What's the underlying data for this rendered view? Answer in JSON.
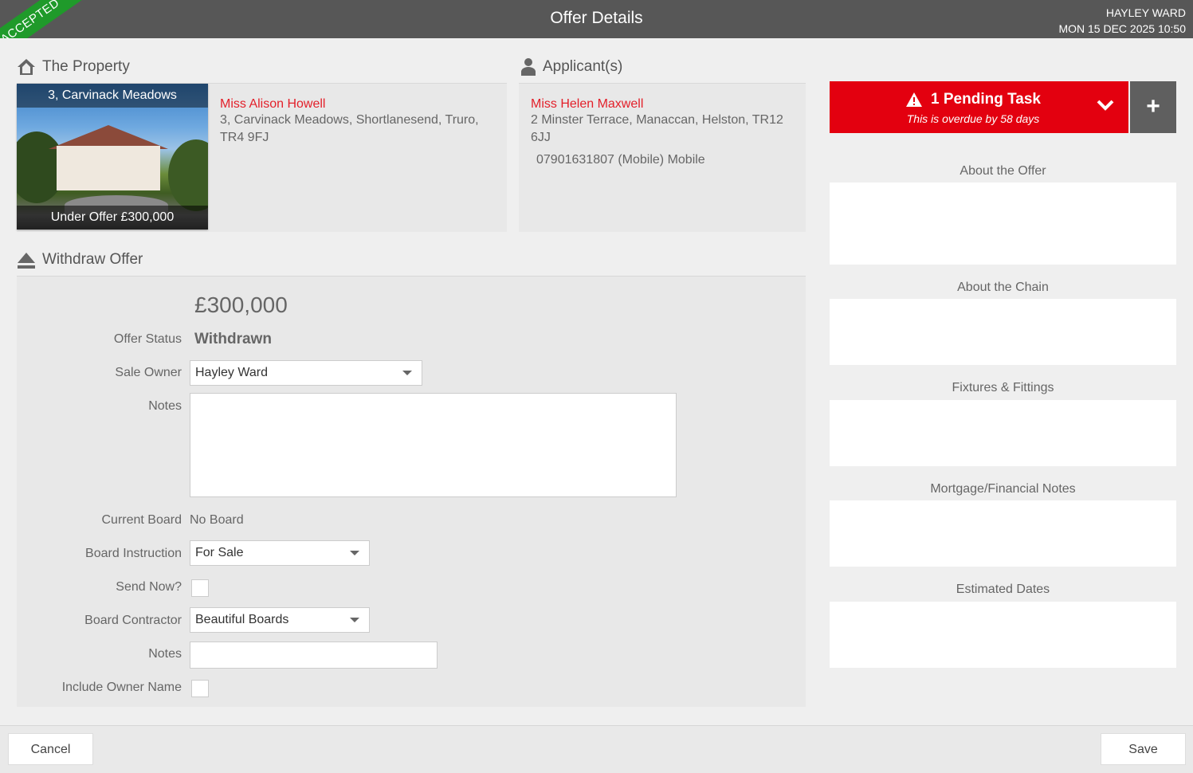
{
  "header": {
    "title": "Offer Details",
    "user_name": "HAYLEY WARD",
    "datetime": "MON 15 DEC 2025 10:50",
    "status_ribbon": "ACCEPTED"
  },
  "property": {
    "section_title": "The Property",
    "photo_caption_top": "3, Carvinack Meadows",
    "photo_caption_bottom": "Under Offer £300,000",
    "owner_name": "Miss Alison Howell",
    "address_line1": "3, Carvinack Meadows, Shortlanesend, Truro,",
    "address_line2": "TR4 9FJ"
  },
  "applicant": {
    "section_title": "Applicant(s)",
    "name": "Miss Helen Maxwell",
    "address_line1": "2 Minster Terrace, Manaccan, Helston, TR12",
    "address_line2": "6JJ",
    "phone": "07901631807 (Mobile) Mobile"
  },
  "withdraw": {
    "section_title": "Withdraw Offer",
    "amount": "£300,000",
    "offer_status_label": "Offer Status",
    "offer_status_value": "Withdrawn",
    "sale_owner_label": "Sale Owner",
    "sale_owner_value": "Hayley Ward",
    "notes_label": "Notes",
    "current_board_label": "Current Board",
    "current_board_value": "No Board",
    "board_instruction_label": "Board Instruction",
    "board_instruction_value": "For Sale",
    "send_now_label": "Send Now?",
    "board_contractor_label": "Board Contractor",
    "board_contractor_value": "Beautiful Boards",
    "notes2_label": "Notes",
    "include_owner_label": "Include Owner Name"
  },
  "task": {
    "title": "1 Pending Task",
    "subtitle": "This is overdue by 58 days",
    "add_label": "+"
  },
  "sidebar": {
    "sections": [
      "About the Offer",
      "About the Chain",
      "Fixtures & Fittings",
      "Mortgage/Financial Notes",
      "Estimated Dates"
    ]
  },
  "footer": {
    "cancel_label": "Cancel",
    "save_label": "Save"
  },
  "colors": {
    "topbar": "#575757",
    "accent_red": "#e3202a",
    "task_red": "#e3000f",
    "ribbon_green": "#1f9a2a"
  }
}
